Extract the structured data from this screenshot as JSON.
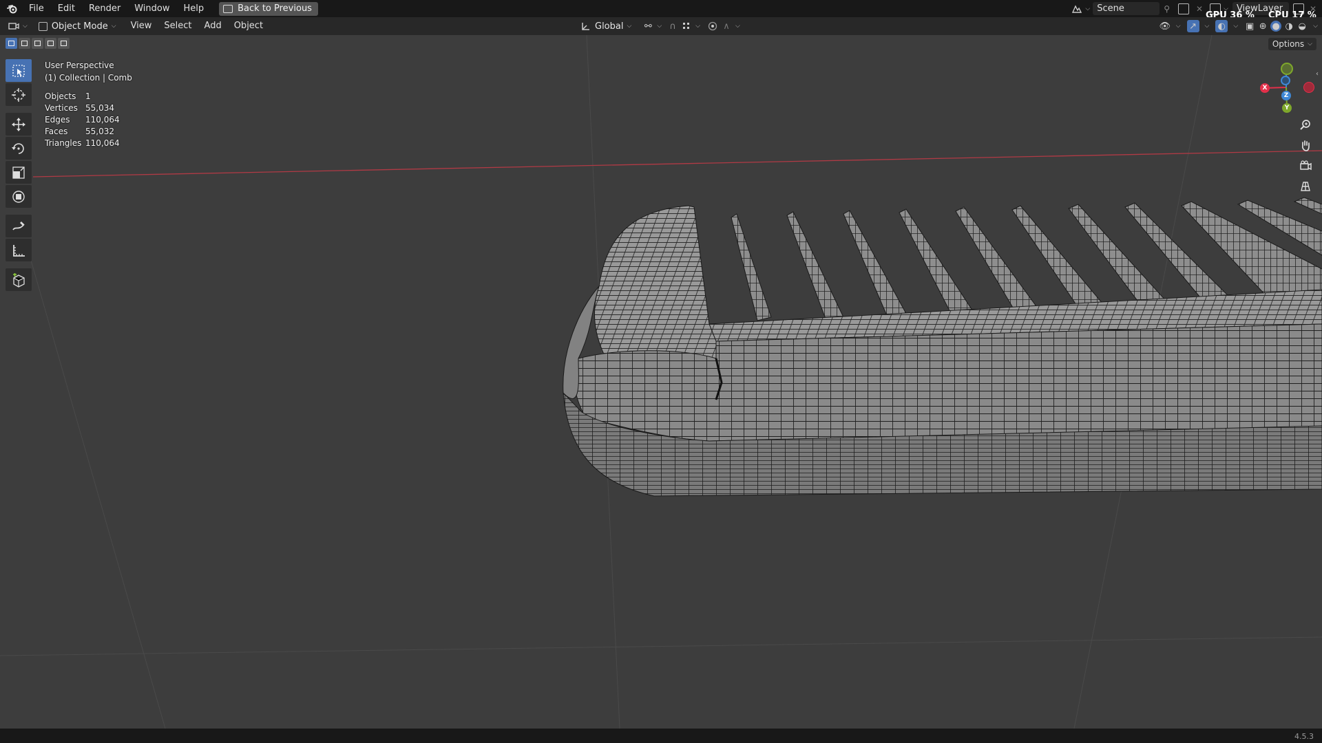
{
  "topbar": {
    "menus": [
      "File",
      "Edit",
      "Render",
      "Window",
      "Help"
    ],
    "back_button": "Back to Previous",
    "scene": "Scene",
    "view_layer": "ViewLayer",
    "gpu_label": "GPU",
    "gpu_value": "36 %",
    "cpu_label": "CPU",
    "cpu_value": "17 %"
  },
  "header": {
    "mode": "Object Mode",
    "menus": [
      "View",
      "Select",
      "Add",
      "Object"
    ],
    "transform_orientation": "Global",
    "options": "Options"
  },
  "viewport": {
    "perspective": "User Perspective",
    "collection": "(1) Collection | Comb",
    "stats": [
      {
        "label": "Objects",
        "value": "1"
      },
      {
        "label": "Vertices",
        "value": "55,034"
      },
      {
        "label": "Edges",
        "value": "110,064"
      },
      {
        "label": "Faces",
        "value": "55,032"
      },
      {
        "label": "Triangles",
        "value": "110,064"
      }
    ]
  },
  "gizmo": {
    "x": "X",
    "y": "Y",
    "z": "Z"
  },
  "tools": [
    "select-box",
    "cursor",
    "move",
    "rotate",
    "scale",
    "transform",
    "annotate",
    "measure",
    "add-cube"
  ],
  "colors": {
    "accent": "#4772b3",
    "x_axis": "#e2304a",
    "y_axis": "#7fa82b",
    "z_axis": "#3f88d6",
    "background": "#3d3d3d"
  },
  "statusbar": {
    "version": "4.5.3"
  }
}
